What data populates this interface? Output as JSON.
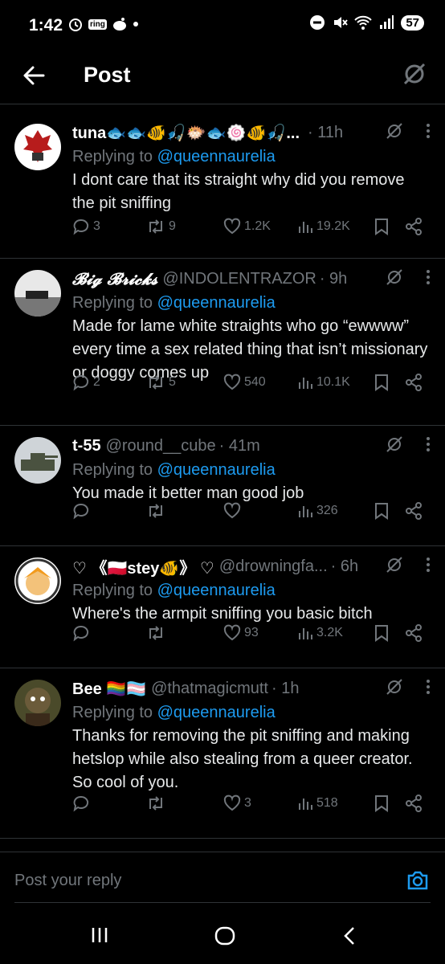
{
  "status": {
    "time": "1:42",
    "ring_label": "ring",
    "battery": "57"
  },
  "header": {
    "title": "Post"
  },
  "tweets": [
    {
      "name": "tuna🐟🐟🐠🎣🐡🐟🍥🐠🎣...",
      "handle": "",
      "time": "· 11h",
      "reply_prefix": "Replying to ",
      "reply_to": "@queennaurelia",
      "text": "I dont care that its straight why did you remove the pit sniffing",
      "replies": "3",
      "reposts": "9",
      "likes": "1.2K",
      "views": "19.2K"
    },
    {
      "name": "𝓑𝓲𝓰 𝓑𝓻𝓲𝓬𝓴𝓼",
      "handle": "@INDOLENTRAZOR",
      "time": "· 9h",
      "reply_prefix": "Replying to ",
      "reply_to": "@queennaurelia",
      "text": "Made for lame white straights who go “ewwww” every time a sex related thing that isn’t missionary or doggy comes up",
      "replies": "2",
      "reposts": "5",
      "likes": "540",
      "views": "10.1K"
    },
    {
      "name": "t-55",
      "handle": "@round__cube",
      "time": "· 41m",
      "reply_prefix": "Replying to ",
      "reply_to": "@queennaurelia",
      "text": "You made it better man good job",
      "replies": "",
      "reposts": "",
      "likes": "",
      "views": "326"
    },
    {
      "name": "♡ 《🇵🇱stey🐠》 ♡",
      "handle": "@drowningfa...",
      "time": "· 6h",
      "reply_prefix": "Replying to ",
      "reply_to": "@queennaurelia",
      "text": "Where's the armpit sniffing you basic bitch",
      "replies": "",
      "reposts": "",
      "likes": "93",
      "views": "3.2K"
    },
    {
      "name": "Bee 🏳️‍🌈🏳️‍⚧️",
      "handle": "@thatmagicmutt",
      "time": "· 1h",
      "reply_prefix": "Replying to ",
      "reply_to": "@queennaurelia",
      "text": "Thanks for removing the pit sniffing and making hetslop while also stealing from a queer creator. So cool of you.",
      "replies": "",
      "reposts": "",
      "likes": "3",
      "views": "518"
    }
  ],
  "composer": {
    "placeholder": "Post your reply"
  },
  "icons": {
    "back": "back-arrow-icon",
    "grok": "grok-icon",
    "more": "more-vertical-icon",
    "reply": "reply-icon",
    "repost": "repost-icon",
    "like": "heart-icon",
    "views": "views-icon",
    "bookmark": "bookmark-icon",
    "share": "share-icon",
    "camera": "camera-icon"
  },
  "colors": {
    "accent": "#1d9bf0",
    "muted": "#71767b",
    "text": "#e7e9ea",
    "divider": "#2f3336"
  }
}
